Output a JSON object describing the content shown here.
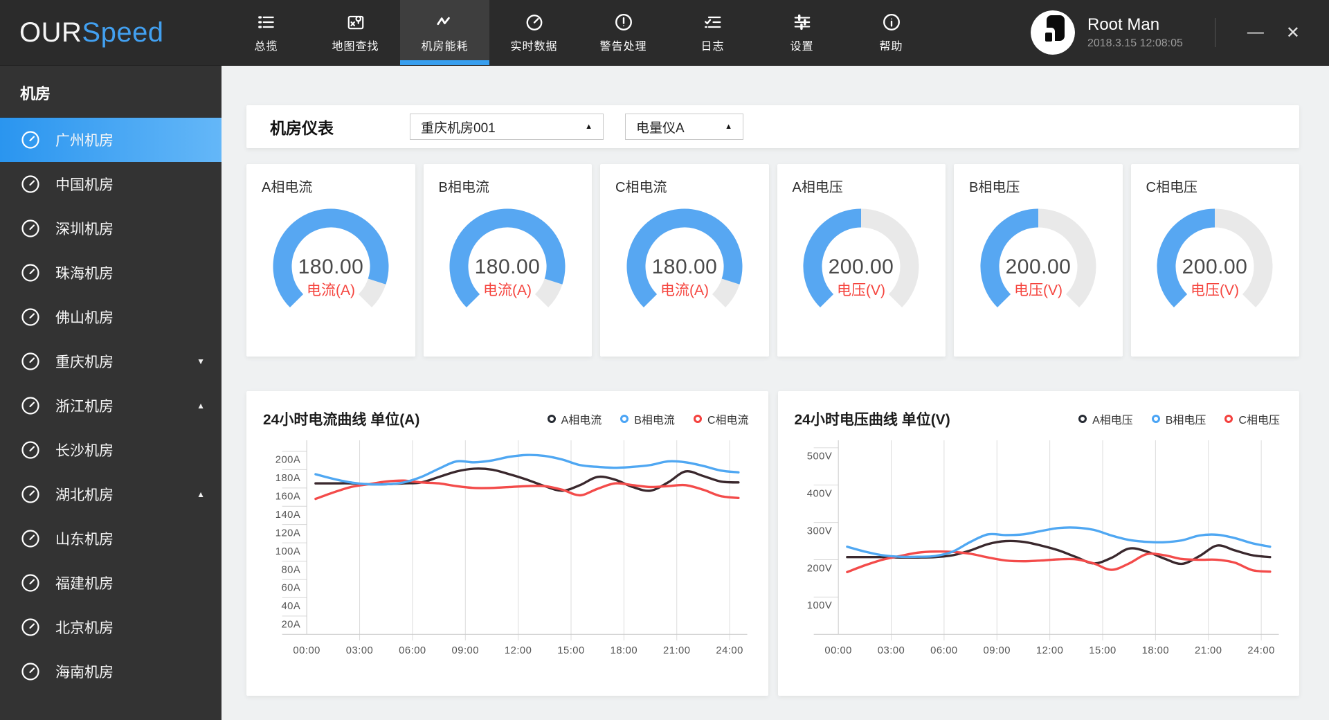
{
  "app": {
    "logo_prefix": "OUR",
    "logo_suffix": "Speed",
    "accent_color": "#42a0f0"
  },
  "navbar": {
    "items": [
      {
        "label": "总揽",
        "icon": "overview-icon",
        "active": false
      },
      {
        "label": "地图查找",
        "icon": "map-search-icon",
        "active": false
      },
      {
        "label": "机房能耗",
        "icon": "energy-icon",
        "active": true
      },
      {
        "label": "实时数据",
        "icon": "realtime-icon",
        "active": false
      },
      {
        "label": "警告处理",
        "icon": "alert-icon",
        "active": false
      },
      {
        "label": "日志",
        "icon": "logs-icon",
        "active": false
      },
      {
        "label": "设置",
        "icon": "settings-icon",
        "active": false
      },
      {
        "label": "帮助",
        "icon": "help-icon",
        "active": false
      }
    ],
    "user": {
      "name": "Root Man",
      "datetime": "2018.3.15 12:08:05"
    },
    "window": {
      "minimize_glyph": "—",
      "close_glyph": "✕"
    }
  },
  "sidebar": {
    "title": "机房",
    "items": [
      {
        "label": "广州机房",
        "active": true,
        "caret": ""
      },
      {
        "label": "中国机房",
        "active": false,
        "caret": ""
      },
      {
        "label": "深圳机房",
        "active": false,
        "caret": ""
      },
      {
        "label": "珠海机房",
        "active": false,
        "caret": ""
      },
      {
        "label": "佛山机房",
        "active": false,
        "caret": ""
      },
      {
        "label": "重庆机房",
        "active": false,
        "caret": "down"
      },
      {
        "label": "浙江机房",
        "active": false,
        "caret": "up"
      },
      {
        "label": "长沙机房",
        "active": false,
        "caret": ""
      },
      {
        "label": "湖北机房",
        "active": false,
        "caret": "up"
      },
      {
        "label": "山东机房",
        "active": false,
        "caret": ""
      },
      {
        "label": "福建机房",
        "active": false,
        "caret": ""
      },
      {
        "label": "北京机房",
        "active": false,
        "caret": ""
      },
      {
        "label": "海南机房",
        "active": false,
        "caret": ""
      }
    ]
  },
  "panel": {
    "title": "机房仪表",
    "caret_glyph": "▲",
    "selects": [
      {
        "value": "重庆机房001"
      },
      {
        "value": "电量仪A"
      }
    ]
  },
  "gauges": {
    "fill_color": "#57a7f2",
    "track_color": "#e9e9e9",
    "value_color": "#4a4a4a",
    "unit_color": "#f5443e",
    "cards": [
      {
        "title": "A相电流",
        "value": "180.00",
        "unit": "电流(A)",
        "max": 200,
        "fraction": 0.9
      },
      {
        "title": "B相电流",
        "value": "180.00",
        "unit": "电流(A)",
        "max": 200,
        "fraction": 0.9
      },
      {
        "title": "C相电流",
        "value": "180.00",
        "unit": "电流(A)",
        "max": 200,
        "fraction": 0.9
      },
      {
        "title": "A相电压",
        "value": "200.00",
        "unit": "电压(V)",
        "max": 400,
        "fraction": 0.5
      },
      {
        "title": "B相电压",
        "value": "200.00",
        "unit": "电压(V)",
        "max": 400,
        "fraction": 0.5
      },
      {
        "title": "C相电压",
        "value": "200.00",
        "unit": "电压(V)",
        "max": 400,
        "fraction": 0.5
      }
    ]
  },
  "chart_data": [
    {
      "type": "line",
      "title": "24小时电流曲线 单位(A)",
      "x_labels": [
        "00:00",
        "03:00",
        "06:00",
        "09:00",
        "12:00",
        "15:00",
        "18:00",
        "21:00",
        "24:00"
      ],
      "x_hours": [
        0,
        1,
        2,
        3,
        4,
        5,
        6,
        7,
        8,
        9,
        10,
        11,
        12,
        13,
        14,
        15,
        16,
        17,
        18,
        19,
        20,
        21,
        22,
        23,
        24
      ],
      "y_ticks": [
        200,
        180,
        160,
        140,
        120,
        100,
        80,
        60,
        40,
        20
      ],
      "y_suffix": "A",
      "y_max": 212,
      "grid": "vertical-gridlines-only",
      "legend_position": "top-right",
      "series": [
        {
          "name": "A相电流",
          "color": "#3a282d",
          "legend_color": "#262b33",
          "values": [
            165,
            165,
            165,
            164,
            164,
            165,
            166,
            172,
            178,
            181,
            180,
            175,
            169,
            162,
            157,
            163,
            172,
            169,
            161,
            157,
            166,
            178,
            173,
            167,
            166
          ]
        },
        {
          "name": "B相电流",
          "color": "#4fa7f2",
          "legend_color": "#4aa4f5",
          "values": [
            175,
            170,
            166,
            164,
            164,
            166,
            172,
            181,
            189,
            188,
            190,
            194,
            196,
            195,
            191,
            185,
            183,
            182,
            183,
            185,
            189,
            188,
            184,
            179,
            177
          ]
        },
        {
          "name": "C相电流",
          "color": "#f34b4a",
          "legend_color": "#f4403d",
          "values": [
            148,
            155,
            161,
            164,
            167,
            168,
            166,
            165,
            162,
            160,
            160,
            161,
            162,
            162,
            158,
            152,
            159,
            165,
            163,
            161,
            162,
            163,
            158,
            151,
            149
          ]
        }
      ]
    },
    {
      "type": "line",
      "title": "24小时电压曲线 单位(V)",
      "x_labels": [
        "00:00",
        "03:00",
        "06:00",
        "09:00",
        "12:00",
        "15:00",
        "18:00",
        "21:00",
        "24:00"
      ],
      "x_hours": [
        0,
        1,
        2,
        3,
        4,
        5,
        6,
        7,
        8,
        9,
        10,
        11,
        12,
        13,
        14,
        15,
        16,
        17,
        18,
        19,
        20,
        21,
        22,
        23,
        24
      ],
      "y_ticks": [
        500,
        400,
        300,
        200,
        100
      ],
      "y_suffix": "V",
      "y_max": 520,
      "grid": "vertical-gridlines-only",
      "legend_position": "top-right",
      "series": [
        {
          "name": "A相电压",
          "color": "#3a282d",
          "legend_color": "#262b33",
          "values": [
            207,
            207,
            207,
            206,
            206,
            207,
            212,
            225,
            242,
            250,
            248,
            238,
            225,
            207,
            190,
            205,
            230,
            222,
            203,
            189,
            210,
            238,
            225,
            212,
            207
          ]
        },
        {
          "name": "B相电压",
          "color": "#4fa7f2",
          "legend_color": "#4aa4f5",
          "values": [
            235,
            222,
            212,
            208,
            208,
            210,
            222,
            248,
            268,
            266,
            268,
            277,
            285,
            286,
            280,
            265,
            253,
            248,
            247,
            252,
            265,
            267,
            258,
            244,
            235
          ]
        },
        {
          "name": "C相电压",
          "color": "#f34b4a",
          "legend_color": "#f4403d",
          "values": [
            167,
            185,
            200,
            210,
            219,
            222,
            221,
            216,
            206,
            198,
            196,
            198,
            201,
            201,
            190,
            173,
            190,
            215,
            212,
            202,
            200,
            200,
            192,
            172,
            168
          ]
        }
      ]
    }
  ]
}
